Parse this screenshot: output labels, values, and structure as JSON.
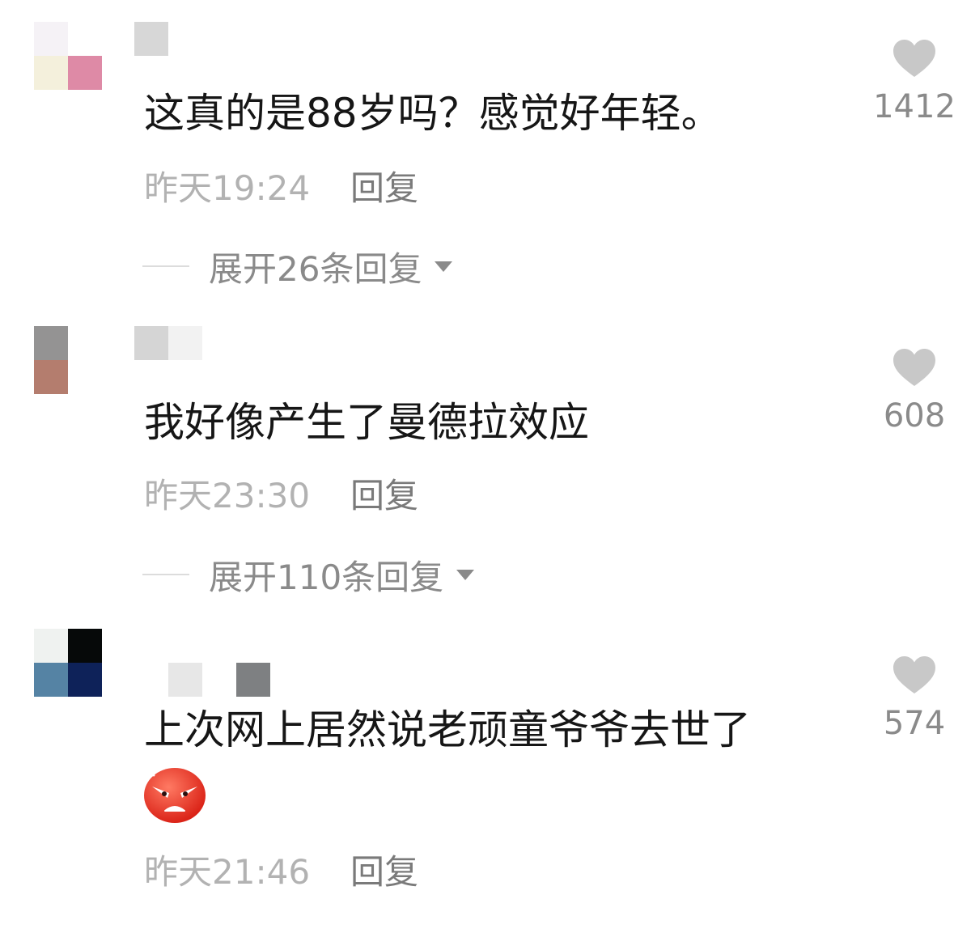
{
  "comments": [
    {
      "text": "这真的是88岁吗？感觉好年轻。",
      "time": "昨天19:24",
      "reply_label": "回复",
      "expand_label": "展开26条回复",
      "likes": "1412",
      "avatar_colors": [
        "#f5f2f6",
        "#ffffff",
        "#f4f0dc",
        "#de8aa6"
      ],
      "name_colors": [
        "#d7d7d7"
      ]
    },
    {
      "text": "我好像产生了曼德拉效应",
      "time": "昨天23:30",
      "reply_label": "回复",
      "expand_label": "展开110条回复",
      "likes": "608",
      "avatar_colors": [
        "#949393",
        "#ffffff",
        "#b47d6e",
        "#ffffff"
      ],
      "name_colors": [
        "#d5d5d5",
        "#f2f2f2"
      ]
    },
    {
      "text_line1": "上次网上居然说老顽童爷爷去世了",
      "emoji": "angry-face-emoji",
      "time": "昨天21:46",
      "reply_label": "回复",
      "likes": "574",
      "avatar_colors": [
        "#eff2f0",
        "#060909",
        "#5583a4",
        "#0e2259"
      ],
      "name_colors": [
        "#e7e7e7",
        "#ffffff",
        "#7e8082"
      ]
    }
  ],
  "colors": {
    "text": "#161616",
    "meta": "#b2b2b2",
    "reply": "#7a7a7a",
    "like_icon": "#c8c8c8",
    "like_count": "#8a8a8a"
  }
}
